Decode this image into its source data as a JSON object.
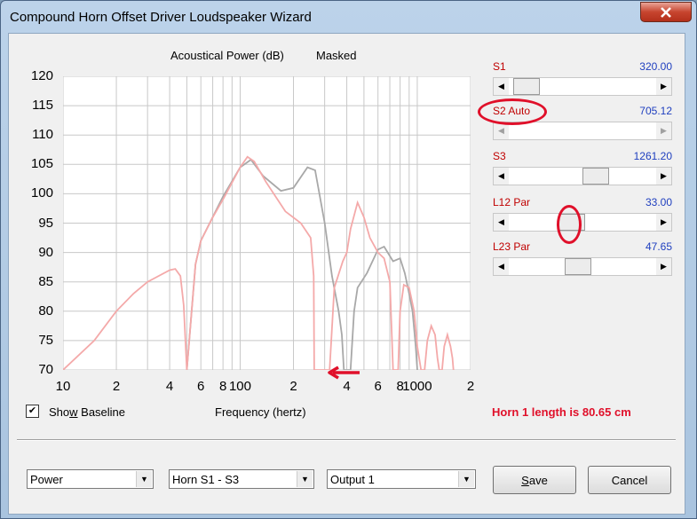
{
  "window": {
    "title": "Compound Horn Offset Driver Loudspeaker Wizard",
    "close_icon": "close-icon"
  },
  "chart_header": {
    "left": "Acoustical Power (dB)",
    "right": "Masked"
  },
  "chart_data": {
    "type": "line",
    "title": "Acoustical Power (dB)   Masked",
    "xlabel": "Frequency (hertz)",
    "ylabel": "",
    "x_scale": "log",
    "xlim": [
      10,
      2000
    ],
    "ylim": [
      70,
      120
    ],
    "y_ticks": [
      "120",
      "115",
      "110",
      "105",
      "100",
      "95",
      "90",
      "85",
      "80",
      "75",
      "70"
    ],
    "x_ticks": [
      "10",
      "2",
      "4",
      "6",
      "8",
      "100",
      "2",
      "4",
      "6",
      "8",
      "1000",
      "2"
    ],
    "x_tick_values": [
      10,
      20,
      40,
      60,
      80,
      100,
      200,
      400,
      600,
      800,
      1000,
      2000
    ],
    "series": [
      {
        "color": "#a8a8a8",
        "points": [
          [
            50,
            70
          ],
          [
            56,
            88
          ],
          [
            60,
            92
          ],
          [
            80,
            99.5
          ],
          [
            100,
            104.5
          ],
          [
            115,
            105.8
          ],
          [
            135,
            103
          ],
          [
            170,
            100.5
          ],
          [
            200,
            101
          ],
          [
            240,
            104.5
          ],
          [
            265,
            104
          ],
          [
            300,
            95
          ],
          [
            330,
            86
          ],
          [
            360,
            80
          ],
          [
            375,
            76
          ],
          [
            385,
            70
          ],
          [
            420,
            70
          ],
          [
            440,
            80
          ],
          [
            460,
            84
          ],
          [
            520,
            86.5
          ],
          [
            600,
            90.5
          ],
          [
            650,
            91
          ],
          [
            730,
            88.5
          ],
          [
            800,
            89
          ],
          [
            850,
            86.5
          ],
          [
            900,
            83
          ],
          [
            940,
            80
          ],
          [
            980,
            74
          ],
          [
            1000,
            70
          ]
        ]
      },
      {
        "color": "#f4a9a9",
        "points": [
          [
            10,
            70
          ],
          [
            15,
            75
          ],
          [
            20,
            80
          ],
          [
            25,
            83
          ],
          [
            30,
            85
          ],
          [
            40,
            87
          ],
          [
            43,
            87.2
          ],
          [
            46,
            86
          ],
          [
            48,
            81
          ],
          [
            50,
            70
          ],
          [
            56,
            88
          ],
          [
            60,
            92
          ],
          [
            70,
            96
          ],
          [
            80,
            99
          ],
          [
            100,
            104.5
          ],
          [
            110,
            106.3
          ],
          [
            120,
            105.5
          ],
          [
            140,
            102
          ],
          [
            180,
            97
          ],
          [
            220,
            95
          ],
          [
            250,
            92.5
          ],
          [
            260,
            86
          ],
          [
            262,
            70
          ],
          [
            320,
            70
          ],
          [
            340,
            84
          ],
          [
            380,
            88.5
          ],
          [
            400,
            90
          ],
          [
            420,
            94
          ],
          [
            460,
            98.5
          ],
          [
            500,
            96
          ],
          [
            540,
            92.5
          ],
          [
            600,
            90
          ],
          [
            650,
            89
          ],
          [
            700,
            85
          ],
          [
            730,
            70
          ],
          [
            780,
            70
          ],
          [
            800,
            80
          ],
          [
            840,
            84.5
          ],
          [
            900,
            84
          ],
          [
            960,
            80
          ],
          [
            1000,
            74
          ],
          [
            1050,
            70
          ],
          [
            1100,
            70
          ],
          [
            1140,
            75
          ],
          [
            1200,
            77.5
          ],
          [
            1260,
            76
          ],
          [
            1300,
            72
          ],
          [
            1330,
            70
          ],
          [
            1380,
            70
          ],
          [
            1420,
            74
          ],
          [
            1480,
            76
          ],
          [
            1540,
            74
          ],
          [
            1580,
            72
          ],
          [
            1600,
            70
          ]
        ]
      }
    ]
  },
  "sliders": [
    {
      "label": "S1",
      "value": "320.00",
      "pos": 0.04,
      "disabled": false
    },
    {
      "label": "S2  Auto",
      "value": "705.12",
      "pos": 0,
      "disabled": true
    },
    {
      "label": "S3",
      "value": "1261.20",
      "pos": 0.61,
      "disabled": false
    },
    {
      "label": "L12  Par",
      "value": "33.00",
      "pos": 0.41,
      "disabled": false
    },
    {
      "label": "L23  Par",
      "value": "47.65",
      "pos": 0.46,
      "disabled": false
    }
  ],
  "show_baseline": {
    "label_pre": "Sho",
    "label_u": "w",
    "label_post": " Baseline",
    "checked": "✔"
  },
  "xaxis_label": "Frequency (hertz)",
  "horn_length": "Horn 1 length is 80.65 cm",
  "dropdowns": [
    {
      "value": "Power"
    },
    {
      "value": "Horn S1 - S3"
    },
    {
      "value": "Output 1"
    }
  ],
  "buttons": {
    "save_u": "S",
    "save_rest": "ave",
    "cancel": "Cancel"
  },
  "colors": {
    "accent_red": "#e0102a",
    "value_blue": "#1f3fbf",
    "label_red": "#c00000"
  }
}
